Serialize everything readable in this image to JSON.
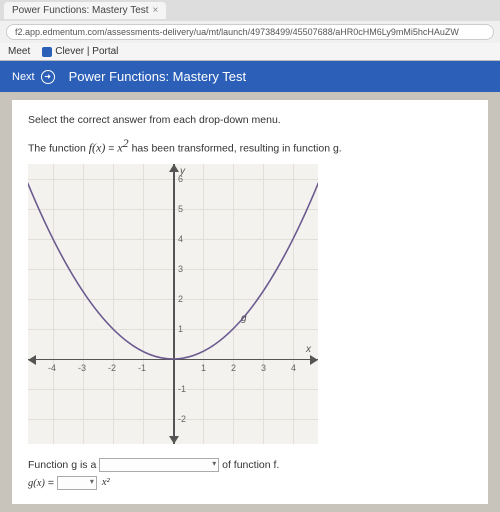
{
  "browser": {
    "tab_title": "Power Functions: Mastery Test",
    "url": "f2.app.edmentum.com/assessments-delivery/ua/mt/launch/49738499/45507688/aHR0cHM6Ly9mMi5hcHAuZW",
    "bookmarks": [
      {
        "label": "Meet"
      },
      {
        "label": "Clever | Portal"
      }
    ]
  },
  "header": {
    "next_label": "Next",
    "title": "Power Functions: Mastery Test"
  },
  "question": {
    "instruction": "Select the correct answer from each drop-down menu.",
    "line_prefix": "The function ",
    "fn_lhs": "f(x)",
    "fn_eq": " = ",
    "fn_rhs_base": "x",
    "fn_rhs_exp": "2",
    "line_suffix": " has been transformed, resulting in function g.",
    "y_axis_label": "y",
    "x_axis_label": "x",
    "g_label": "g",
    "answer_l1_a": "Function g is a ",
    "answer_l1_b": " of function f.",
    "answer_l2_a": "g(x)",
    "answer_l2_eq": " = ",
    "dd2_option": "x²"
  },
  "chart_data": {
    "type": "line",
    "title": "",
    "xlabel": "x",
    "ylabel": "y",
    "xlim": [
      -4.5,
      4.5
    ],
    "ylim": [
      -2.5,
      6.5
    ],
    "x_ticks": [
      -4,
      -3,
      -2,
      -1,
      1,
      2,
      3,
      4
    ],
    "y_ticks": [
      -2,
      -1,
      1,
      2,
      3,
      4,
      5,
      6
    ],
    "series": [
      {
        "name": "g",
        "x": [
          -5,
          -4,
          -3,
          -2,
          -1,
          0,
          1,
          2,
          3,
          4,
          5
        ],
        "values": [
          6.25,
          4.0,
          2.25,
          1.0,
          0.25,
          0.0,
          0.25,
          1.0,
          2.25,
          4.0,
          6.25
        ]
      }
    ],
    "grid": true,
    "legend_position": "inside-right"
  }
}
